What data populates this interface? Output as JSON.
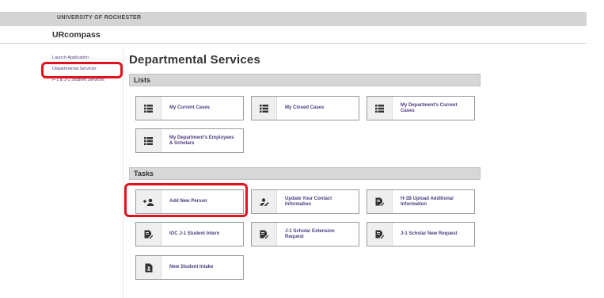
{
  "header": {
    "university": "UNIVERSITY OF ROCHESTER",
    "app_name": "URcompass"
  },
  "sidebar": {
    "items": [
      {
        "label": "Launch Application"
      },
      {
        "label": "Departmental Services"
      },
      {
        "label": "F-1 & J-1 Student Services"
      }
    ]
  },
  "main": {
    "title": "Departmental Services",
    "lists": {
      "heading": "Lists",
      "cards": [
        {
          "label": "My Current Cases",
          "icon": "list-icon"
        },
        {
          "label": "My Closed Cases",
          "icon": "list-icon"
        },
        {
          "label": "My Department's Current Cases",
          "icon": "list-icon"
        },
        {
          "label": "My Department's Employees & Scholars",
          "icon": "list-icon"
        }
      ]
    },
    "tasks": {
      "heading": "Tasks",
      "cards": [
        {
          "label": "Add New Person",
          "icon": "add-person-icon"
        },
        {
          "label": "Update Your Contact Information",
          "icon": "edit-person-icon"
        },
        {
          "label": "H-1B Upload Additional Information",
          "icon": "edit-form-icon"
        },
        {
          "label": "IOC J-1 Student Intern",
          "icon": "edit-form-icon"
        },
        {
          "label": "J-1 Scholar Extension Request",
          "icon": "edit-form-icon"
        },
        {
          "label": "J-1 Scholar New Request",
          "icon": "edit-form-icon"
        },
        {
          "label": "New Student Intake",
          "icon": "document-icon"
        }
      ]
    }
  },
  "colors": {
    "highlight": "#e0141e",
    "link": "#4e3a80",
    "section_bar": "#d7d7d7"
  }
}
